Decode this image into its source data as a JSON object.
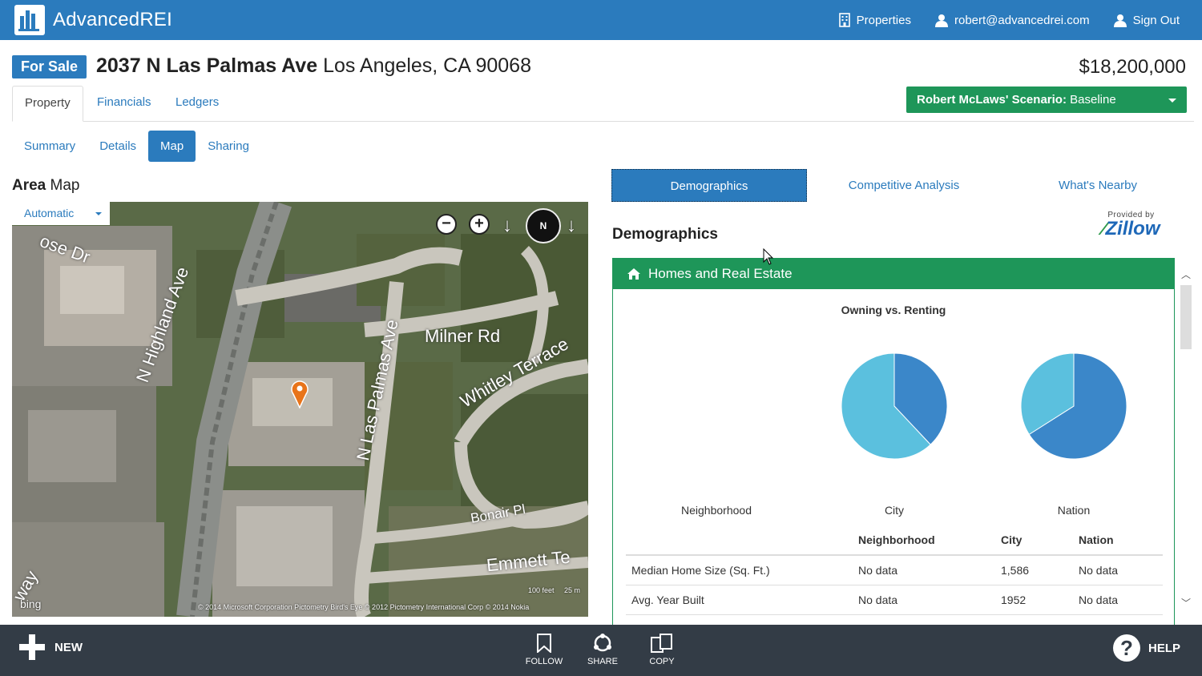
{
  "app": {
    "brand": "AdvancedREI"
  },
  "topnav": {
    "properties": "Properties",
    "email": "robert@advancedrei.com",
    "signout": "Sign Out"
  },
  "property": {
    "status": "For Sale",
    "street": "2037 N Las Palmas Ave",
    "city": "Los Angeles, CA 90068",
    "price": "$18,200,000"
  },
  "tabs": [
    "Property",
    "Financials",
    "Ledgers"
  ],
  "scenario": {
    "owner": "Robert McLaws' Scenario:",
    "value": "Baseline"
  },
  "subtabs": [
    "Summary",
    "Details",
    "Map",
    "Sharing"
  ],
  "map": {
    "title_bold": "Area",
    "title_rest": "Map",
    "mode": "Automatic",
    "compass": "N",
    "streets": [
      "Milner Rd",
      "N Highland Ave",
      "N Las Palmas Ave",
      "Whitley Terrace",
      "Bonair Pl",
      "Emmett Te",
      "way",
      "ose Dr"
    ],
    "copyright": "© 2014 Microsoft Corporation     Pictometry Bird's Eye © 2012 Pictometry International Corp     © 2014 Nokia",
    "attribution": "bing",
    "scale_feet": "100 feet",
    "scale_m": "25 m"
  },
  "right_tabs": [
    "Demographics",
    "Competitive Analysis",
    "What's Nearby"
  ],
  "demographics": {
    "heading": "Demographics",
    "provided_by": "Provided by",
    "zillow_logo": "Zillow",
    "panel_title": "Homes and Real Estate",
    "chart_title": "Owning vs. Renting",
    "pie_labels": [
      "Neighborhood",
      "City",
      "Nation"
    ]
  },
  "chart_data": {
    "type": "pie",
    "title": "Owning vs. Renting",
    "categories": [
      "Neighborhood",
      "City",
      "Nation"
    ],
    "series": [
      {
        "values": [
          0,
          0.38,
          0.66
        ]
      },
      {
        "values": [
          0,
          0.62,
          0.34
        ]
      }
    ],
    "colors": [
      "#3b87c9",
      "#5bc0de"
    ]
  },
  "table": {
    "headers": [
      "",
      "Neighborhood",
      "City",
      "Nation"
    ],
    "rows": [
      [
        "Median Home Size (Sq. Ft.)",
        "No data",
        "1,586",
        "No data"
      ],
      [
        "Avg. Year Built",
        "No data",
        "1952",
        "No data"
      ]
    ]
  },
  "bottombar": {
    "new": "NEW",
    "follow": "FOLLOW",
    "share": "SHARE",
    "copy": "COPY",
    "help": "HELP"
  }
}
